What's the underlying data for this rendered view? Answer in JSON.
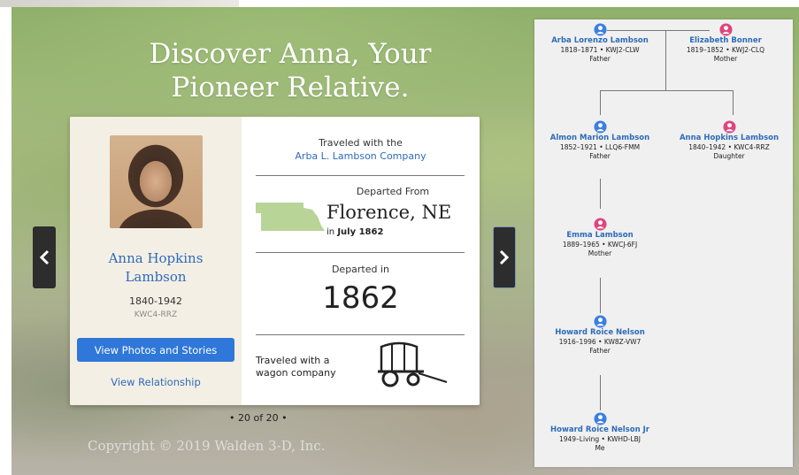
{
  "hero": {
    "title_line1": "Discover Anna, Your",
    "title_line2": "Pioneer Relative."
  },
  "card": {
    "person": {
      "name_line1": "Anna Hopkins",
      "name_line2": "Lambson",
      "years": "1840-1942",
      "pid": "KWC4-RRZ"
    },
    "buttons": {
      "photos": "View Photos and Stories",
      "relationship": "View Relationship"
    },
    "traveled_with_label": "Traveled with the",
    "company": "Arba L. Lambson Company",
    "departed_from_label": "Departed From",
    "departed_city": "Florence, NE",
    "departed_date_prefix": "in",
    "departed_date": "July 1862",
    "departed_in_label": "Departed in",
    "departed_year": "1862",
    "wagon_line1": "Traveled with a",
    "wagon_line2": "wagon company"
  },
  "pager": "• 20 of 20 •",
  "copyright": "Copyright © 2019 Walden 3-D, Inc.",
  "tree": {
    "nodes": [
      {
        "name": "Arba Lorenzo Lambson",
        "meta": "1818–1871 • KWJ2-CLW",
        "rel": "Father",
        "gender": "male"
      },
      {
        "name": "Elizabeth Bonner",
        "meta": "1819–1852 • KWJ2-CLQ",
        "rel": "Mother",
        "gender": "female"
      },
      {
        "name": "Almon Marion Lambson",
        "meta": "1852–1921 • LLQ6-FMM",
        "rel": "Father",
        "gender": "male"
      },
      {
        "name": "Anna Hopkins Lambson",
        "meta": "1840–1942 • KWC4-RRZ",
        "rel": "Daughter",
        "gender": "female"
      },
      {
        "name": "Emma Lambson",
        "meta": "1889–1965 • KWCJ-6FJ",
        "rel": "Mother",
        "gender": "female"
      },
      {
        "name": "Howard Roice Nelson",
        "meta": "1916–1996 • KW8Z-VW7",
        "rel": "Father",
        "gender": "male"
      },
      {
        "name": "Howard Roice Nelson Jr",
        "meta": "1949–Living • KWHD-LBJ",
        "rel": "Me",
        "gender": "male"
      }
    ]
  },
  "colors": {
    "link": "#2e6bb8",
    "button": "#2f77d8",
    "male": "#3b7fe0",
    "female": "#e0457b"
  }
}
